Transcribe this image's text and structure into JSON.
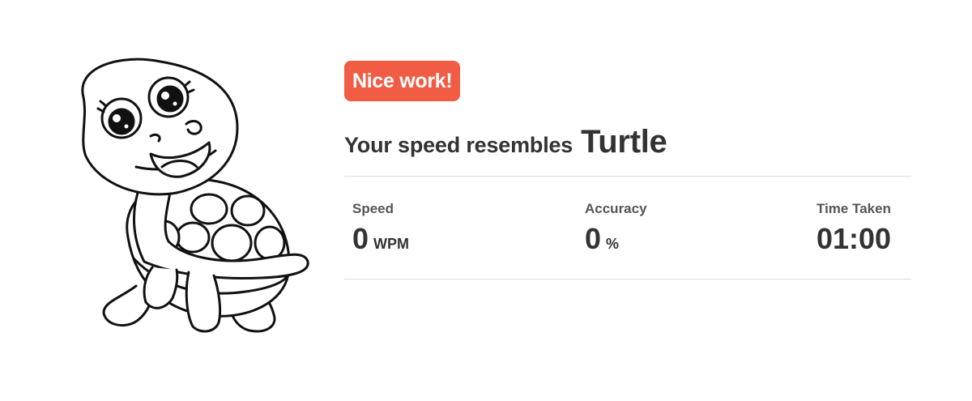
{
  "result": {
    "badge": "Nice work!",
    "headline_prefix": "Your speed resembles",
    "animal": "Turtle"
  },
  "stats": {
    "speed": {
      "label": "Speed",
      "value": "0",
      "unit": "WPM"
    },
    "accuracy": {
      "label": "Accuracy",
      "value": "0",
      "unit": "%"
    },
    "time": {
      "label": "Time Taken",
      "value": "01:00"
    }
  },
  "colors": {
    "badge_background": "#f15c45",
    "text": "#333333"
  },
  "icons": {
    "illustration": "turtle-illustration-icon"
  }
}
